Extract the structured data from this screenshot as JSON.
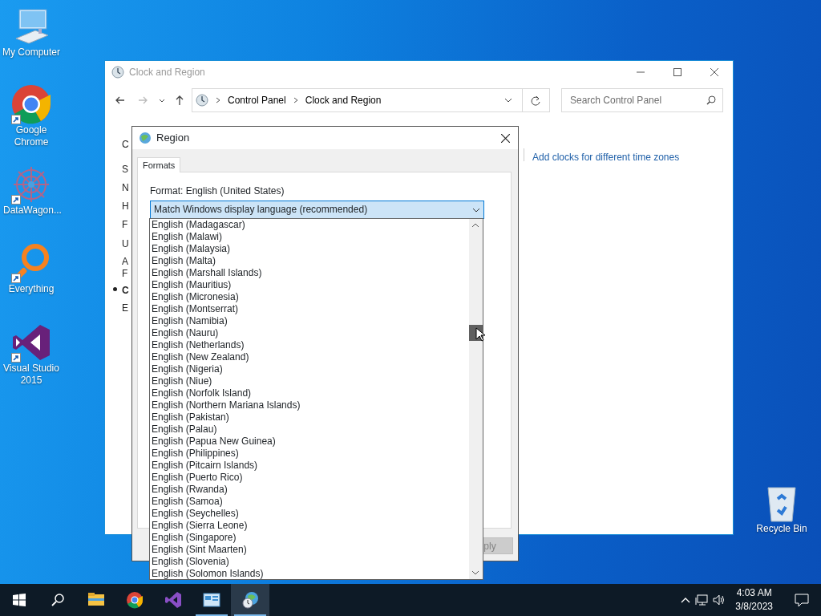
{
  "desktop_icons": [
    {
      "kind": "computer",
      "label": "My Computer",
      "shortcut": false
    },
    {
      "kind": "chrome",
      "label": "Google Chrome",
      "shortcut": true
    },
    {
      "kind": "datawagon",
      "label": "DataWagon...",
      "shortcut": true
    },
    {
      "kind": "everything",
      "label": "Everything",
      "shortcut": true
    },
    {
      "kind": "vs",
      "label": "Visual Studio 2015",
      "shortcut": true
    },
    {
      "kind": "recycle",
      "label": "Recycle Bin",
      "shortcut": false
    }
  ],
  "control_panel": {
    "title": "Clock and Region",
    "breadcrumbs": [
      "Control Panel",
      "Clock and Region"
    ],
    "search": {
      "placeholder": "Search Control Panel"
    },
    "text_fragments": [
      {
        "text": "C",
        "bold": false
      },
      {
        "text": "S",
        "bold": false
      },
      {
        "text": "N",
        "bold": false
      },
      {
        "text": "H",
        "bold": false
      },
      {
        "text": "F",
        "bold": false
      },
      {
        "text": "U",
        "bold": false
      },
      {
        "text": "A",
        "bold": false
      },
      {
        "text": "F",
        "bold": false
      },
      {
        "text": "C",
        "bold": true
      },
      {
        "text": "E",
        "bold": false
      }
    ],
    "link": "Add clocks for different time zones"
  },
  "region_dialog": {
    "title": "Region",
    "tabs": [
      {
        "label": "Formats",
        "selected": true
      }
    ],
    "format_label": "Format: English (United States)",
    "dropdown": {
      "value": "Match Windows display language (recommended)",
      "expanded": true,
      "options": [
        "English (Madagascar)",
        "English (Malawi)",
        "English (Malaysia)",
        "English (Malta)",
        "English (Marshall Islands)",
        "English (Mauritius)",
        "English (Micronesia)",
        "English (Montserrat)",
        "English (Namibia)",
        "English (Nauru)",
        "English (Netherlands)",
        "English (New Zealand)",
        "English (Nigeria)",
        "English (Niue)",
        "English (Norfolk Island)",
        "English (Northern Mariana Islands)",
        "English (Pakistan)",
        "English (Palau)",
        "English (Papua New Guinea)",
        "English (Philippines)",
        "English (Pitcairn Islands)",
        "English (Puerto Rico)",
        "English (Rwanda)",
        "English (Samoa)",
        "English (Seychelles)",
        "English (Sierra Leone)",
        "English (Singapore)",
        "English (Sint Maarten)",
        "English (Slovenia)",
        "English (Solomon Islands)"
      ]
    },
    "apply_button": {
      "label": "ply",
      "disabled": true
    }
  },
  "taskbar": {
    "apps": [
      {
        "kind": "explorer",
        "active": false,
        "open": false
      },
      {
        "kind": "chrome",
        "active": false,
        "open": false
      },
      {
        "kind": "vs",
        "active": false,
        "open": false
      },
      {
        "kind": "control",
        "active": false,
        "open": true
      },
      {
        "kind": "region",
        "active": true,
        "open": true
      }
    ],
    "time": "4:03 AM",
    "date": "3/8/2023"
  }
}
